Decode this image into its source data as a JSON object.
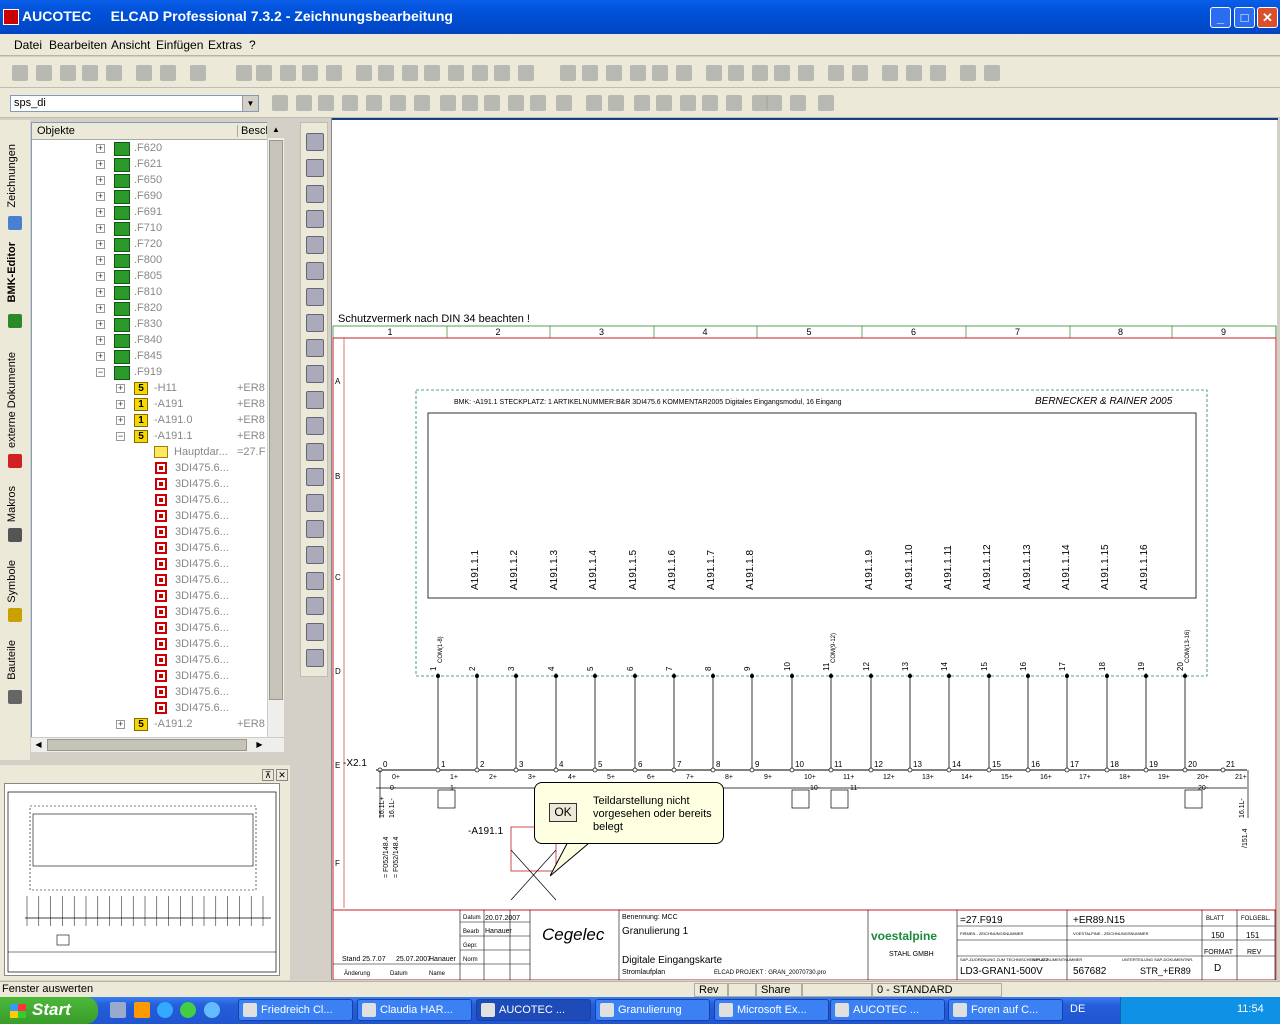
{
  "window": {
    "title": "AUCOTEC     ELCAD Professional 7.3.2 - Zeichnungsbearbeitung",
    "minimize": "_",
    "maximize": "□",
    "close": "✕"
  },
  "menu": [
    "Datei",
    "Bearbeiten",
    "Ansicht",
    "Einfügen",
    "Extras",
    "?"
  ],
  "combo": {
    "value": "sps_di"
  },
  "vtabs": [
    "Zeichnungen",
    "BMK-Editor",
    "externe Dokumente",
    "Makros",
    "Symbole",
    "Bauteile"
  ],
  "tree": {
    "headers": [
      "Objekte",
      "Besch"
    ],
    "f_items": [
      ".F620",
      ".F621",
      ".F650",
      ".F690",
      ".F691",
      ".F710",
      ".F720",
      ".F800",
      ".F805",
      ".F810",
      ".F820",
      ".F830",
      ".F840",
      ".F845",
      ".F919"
    ],
    "children": [
      {
        "label": "-H11",
        "col": "+ER8"
      },
      {
        "label": "-A191",
        "col": "+ER8"
      },
      {
        "label": "-A191.0",
        "col": "+ER8"
      },
      {
        "label": "-A191.1",
        "col": "+ER8"
      }
    ],
    "haupt": {
      "label": "Hauptdar...",
      "col": "=27.F"
    },
    "items": [
      "3DI475.6...",
      "3DI475.6...",
      "3DI475.6...",
      "3DI475.6...",
      "3DI475.6...",
      "3DI475.6...",
      "3DI475.6...",
      "3DI475.6...",
      "3DI475.6...",
      "3DI475.6...",
      "3DI475.6...",
      "3DI475.6...",
      "3DI475.6...",
      "3DI475.6...",
      "3DI475.6...",
      "3DI475.6..."
    ],
    "last": {
      "label": "-A191.2",
      "col": "+ER8"
    }
  },
  "drawing": {
    "notice": "Schutzvermerk nach DIN 34 beachten !",
    "columns": [
      "1",
      "2",
      "3",
      "4",
      "5",
      "6",
      "7",
      "8",
      "9"
    ],
    "rows": [
      "A",
      "B",
      "C",
      "D",
      "E",
      "F"
    ],
    "header_line": "BMK: -A191.1 STECKPLATZ: 1     ARTIKELNUMMER:B&R 3DI475.6   KOMMENTAR2005 Digitales Eingangsmodul, 16 Eingang",
    "brand": "BERNECKER & RAINER 2005",
    "channels": [
      "A191.1.1",
      "A191.1.2",
      "A191.1.3",
      "A191.1.4",
      "A191.1.5",
      "A191.1.6",
      "A191.1.7",
      "A191.1.8",
      "A191.1.9",
      "A191.1.10",
      "A191.1.11",
      "A191.1.12",
      "A191.1.13",
      "A191.1.14",
      "A191.1.15",
      "A191.1.16"
    ],
    "terminal_nums": [
      "1",
      "2",
      "3",
      "4",
      "5",
      "6",
      "7",
      "8",
      "9",
      "10",
      "11",
      "12",
      "13",
      "14",
      "15",
      "16",
      "17",
      "18",
      "19",
      "20"
    ],
    "com_labels": [
      "COM(1-8)",
      "COM(9-12)",
      "COM(13-16)"
    ],
    "x_label": "-X2.1",
    "x_terms": [
      "0",
      "1",
      "2",
      "3",
      "4",
      "5",
      "6",
      "7",
      "8",
      "9",
      "10",
      "11",
      "12",
      "13",
      "14",
      "15",
      "16",
      "17",
      "18",
      "19",
      "20",
      "21"
    ],
    "x_plus": [
      "0+",
      "1+",
      "2+",
      "3+",
      "4+",
      "5+",
      "6+",
      "7+",
      "8+",
      "9+",
      "10+",
      "11+",
      "12+",
      "13+",
      "14+",
      "15+",
      "16+",
      "17+",
      "18+",
      "19+",
      "20+",
      "21+"
    ],
    "x_minus": [
      "0-",
      "1-",
      "10-",
      "11-",
      "20-"
    ],
    "left_refs": [
      "16.1L+",
      "16.1L-",
      "= F052/148.4",
      "= F052/148.4"
    ],
    "right_refs": [
      "16.1L-",
      "/151.4"
    ],
    "part_label": "-A191.1",
    "title_block": {
      "datum_label": "Datum",
      "datum": "20.07.2007",
      "bearb_label": "Bearb",
      "bearb": "Hanauer",
      "gepr_label": "Gepr.",
      "norm_label": "Norm",
      "stand": "Stand 25.7.07",
      "stand_date": "25.07.2007",
      "stand_name": "Hanauer",
      "aenderung": "Änderung",
      "datum2": "Datum",
      "name2": "Name",
      "company": "Cegelec",
      "benennung_label": "Benennung: MCC",
      "benennung1": "Granulierung 1",
      "benennung2": "Digitale Eingangskarte",
      "stromlauf": "Stromlaufplan",
      "projekt": "ELCAD PROJEKT : GRAN_20070730.pro",
      "customer": "voestalpine",
      "customer_sub": "STAHL GMBH",
      "anlage": "=27.F919",
      "ort": "+ER89.N15",
      "firmen": "FIRMEN - ZEICHNUNGSNUMMER",
      "voest_nr": "VOESTALPINE - ZEICHNUNGSNUMMER",
      "sap_zu": "SAP-ZUORDNUNG ZUM TECHNISCHEN PLATZ",
      "sap_dok": "SAP-DOKUMENTNUMMER",
      "unter": "UNTERTEILUNG SAP-DOKUMENTNR.",
      "dwg": "LD3-GRAN1-500V",
      "sapnr": "567682",
      "str": "STR_+ER89",
      "blatt_label": "BLATT",
      "folge_label": "FOLGEBL.",
      "blatt": "150",
      "folge": "151",
      "format_label": "FORMAT",
      "rev_label": "REV",
      "format": "D"
    }
  },
  "balloon": {
    "ok": "OK",
    "text": "Teildarstellung nicht vorgesehen oder bereits belegt"
  },
  "status": {
    "text": "Fenster auswerten",
    "rev": "Rev",
    "share": "Share",
    "layer": "0 - STANDARD"
  },
  "taskbar": {
    "start": "Start",
    "tasks": [
      "Friedreich Cl...",
      "Claudia HAR...",
      "AUCOTEC    ...",
      "Granulierung",
      "Microsoft Ex...",
      "AUCOTEC    ...",
      "Foren auf C..."
    ],
    "lang": "DE",
    "clock": "11:54"
  }
}
